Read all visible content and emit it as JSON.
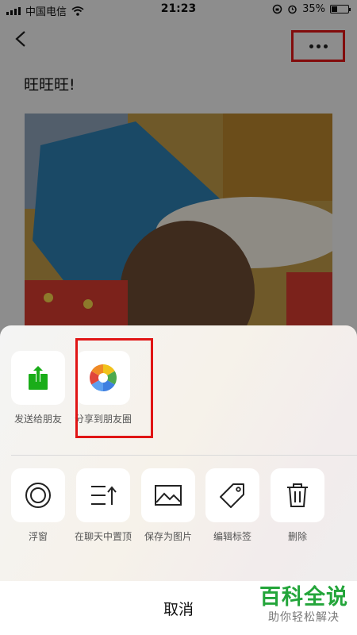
{
  "status_bar": {
    "carrier": "中国电信",
    "time": "21:23",
    "battery_percent": "35%",
    "battery_level": 0.35
  },
  "nav": {
    "back_icon": "chevron-left-icon",
    "more_icon": "more-dots-icon"
  },
  "post": {
    "title": "旺旺旺!"
  },
  "sheet": {
    "share_row": [
      {
        "label": "发送给朋友",
        "icon": "share-upload-icon",
        "icon_color": "#1aad19"
      },
      {
        "label": "分享到朋友圈",
        "icon": "moments-aperture-icon"
      }
    ],
    "action_row": [
      {
        "label": "浮窗",
        "icon": "float-window-icon"
      },
      {
        "label": "在聊天中置顶",
        "icon": "pin-to-top-icon"
      },
      {
        "label": "保存为图片",
        "icon": "image-icon"
      },
      {
        "label": "编辑标签",
        "icon": "tag-icon"
      },
      {
        "label": "删除",
        "icon": "trash-icon"
      }
    ],
    "cancel_label": "取消"
  },
  "watermark": {
    "main": "百科全说",
    "sub": "助你轻松解决"
  },
  "colors": {
    "highlight": "#e01515",
    "wechat_green": "#1aad19",
    "watermark_green": "#23a53a"
  }
}
